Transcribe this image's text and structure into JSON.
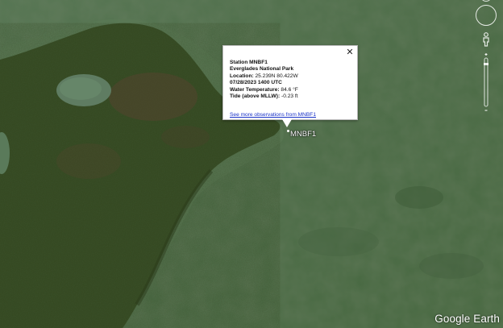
{
  "balloon": {
    "title": "Station MNBF1",
    "park": "Everglades National Park",
    "location_label": "Location:",
    "location_value": "25.239N 80.422W",
    "datetime": "07/28/2023 1400 UTC",
    "water_temp_label": "Water Temperature:",
    "water_temp_value": "84.6 °F",
    "tide_label": "Tide (above MLLW):",
    "tide_value": "-0.23 ft",
    "link_text": "See more observations from MNBF1",
    "close_glyph": "✕"
  },
  "placemark": {
    "label": "MNBF1"
  },
  "branding": {
    "logo_text": "Google Earth"
  },
  "colors": {
    "water": "#4d6c48",
    "land": "#33471f",
    "link": "#1a33c8"
  },
  "icons": {
    "close": "close-icon",
    "compass": "compass-icon",
    "street_view": "pegman-icon",
    "zoom": "zoom-slider-icon"
  }
}
